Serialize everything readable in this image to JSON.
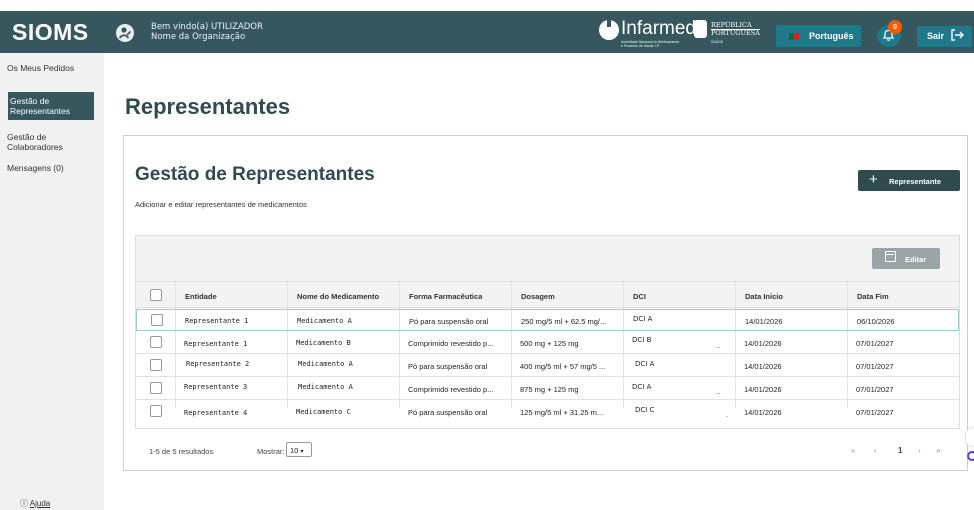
{
  "app": {
    "brand": "SIOMS",
    "welcome_line1": "Bem vindo(a) UTILIZADOR",
    "welcome_line2": "Nome da Organização",
    "infarmed_name": "Infarmed",
    "infarmed_sub": "Autoridade Nacional do Medicamento e Produtos de Saúde I.P.",
    "republica_line1": "REPÚBLICA",
    "republica_line2": "PORTUGUESA",
    "republica_saude": "SAÚDE",
    "language": "Português",
    "notifications_count": "0",
    "logout": "Sair",
    "icons": [
      "user-icon",
      "bell-icon",
      "logout-icon",
      "flag-pt-icon"
    ]
  },
  "sidebar": {
    "items": [
      {
        "label": "Os Meus Pedidos",
        "active": false
      },
      {
        "label": "Gestão de Representantes",
        "active": true
      },
      {
        "label": "Gestão de Colaboradores",
        "active": false
      },
      {
        "label": "Mensagens (0)",
        "active": false
      }
    ],
    "help": "Ajuda",
    "help_icon": "?"
  },
  "main": {
    "page_title": "Representantes",
    "card_title": "Gestão de Representantes",
    "card_subtitle": "Adicionar e editar representantes de medicamentos",
    "add_button": "Representante",
    "edit_button": "Editar"
  },
  "table": {
    "columns": [
      "Entidade",
      "Nome do Medicamento",
      "Forma Farmacêutica",
      "Dosagem",
      "DCI",
      "Data Início",
      "Data Fim"
    ],
    "rows": [
      {
        "entidade": "Representante 1",
        "medicamento": "Medicamento A",
        "forma": "Pó para suspensão oral",
        "dosagem": "250 mg/5 ml + 62.5 mg/...",
        "dci": "DCI A",
        "dci_dot": "",
        "inicio": "14/01/2026",
        "fim": "06/10/2026"
      },
      {
        "entidade": "Representante 1",
        "medicamento": "Medicamento B",
        "forma": "Comprimido revestido p...",
        "dosagem": "500 mg + 125 mg",
        "dci": "DCI B",
        "dci_dot": "..",
        "inicio": "14/01/2026",
        "fim": "07/01/2027"
      },
      {
        "entidade": "Representante 2",
        "medicamento": "Medicamento A",
        "forma": "Pó para suspensão oral",
        "dosagem": "400 mg/5 ml + 57 mg/5 ...",
        "dci": "DCI A",
        "dci_dot": "",
        "inicio": "14/01/2026",
        "fim": "07/01/2027"
      },
      {
        "entidade": "Representante 3",
        "medicamento": "Medicamento A",
        "forma": "Comprimido revestido p...",
        "dosagem": "875 mg + 125 mg",
        "dci": "DCI A",
        "dci_dot": "..",
        "inicio": "14/01/2026",
        "fim": "07/01/2027"
      },
      {
        "entidade": "Representante 4",
        "medicamento": "Medicamento C",
        "forma": "Pó para suspensão oral",
        "dosagem": "125 mg/5 ml + 31.25 m...",
        "dci": "DCI C",
        "dci_dot": ".",
        "inicio": "14/01/2026",
        "fim": "07/01/2027"
      }
    ]
  },
  "pagination": {
    "results": "1-5 de 5 resultados",
    "show_label": "Mostrar:",
    "page_size": "10",
    "first": "«",
    "prev": "‹",
    "current": "1",
    "next": "›",
    "last": "»"
  }
}
